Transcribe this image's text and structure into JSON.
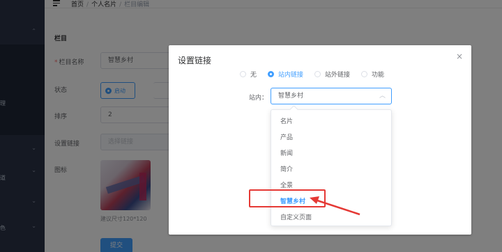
{
  "breadcrumb": {
    "home": "首页",
    "level1": "个人名片",
    "current": "栏目编辑"
  },
  "form": {
    "section_title": "栏目",
    "name_label": "栏目名称",
    "name_value": "智慧乡村",
    "status_label": "状态",
    "status_option_on": "启动",
    "order_label": "排序",
    "order_value": "2",
    "link_label": "设置链接",
    "link_placeholder": "选择链接",
    "icon_label": "图标",
    "icon_tip": "建议尺寸120*120",
    "submit_label": "提交"
  },
  "sidebar": {
    "frag1": "理",
    "frag2": "道",
    "frag3": "色"
  },
  "dialog": {
    "title": "设置链接",
    "close_glyph": "×",
    "link_types": [
      "无",
      "站内链接",
      "站外链接",
      "功能"
    ],
    "selected_type": "站内链接",
    "field_label": "站内：",
    "select_value": "智慧乡村",
    "options": [
      "名片",
      "产品",
      "新闻",
      "简介",
      "全景",
      "智慧乡村",
      "自定义页面"
    ],
    "selected_option": "智慧乡村"
  },
  "colors": {
    "primary": "#409eff",
    "annotation": "#e53935",
    "sidebar": "#2b3347"
  },
  "icons": [
    "hamburger-icon",
    "close-icon",
    "chevron-up-icon",
    "chevron-down-icon"
  ]
}
